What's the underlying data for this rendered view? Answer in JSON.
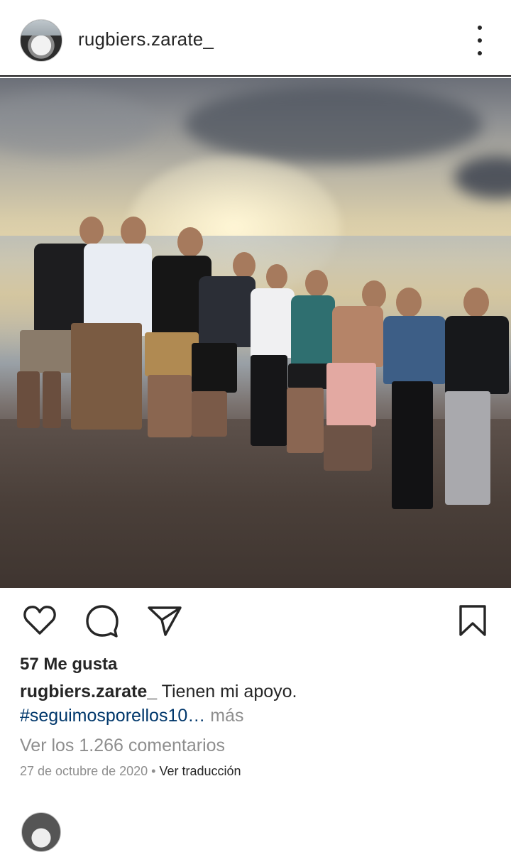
{
  "post": {
    "username": "rugbiers.zarate_",
    "likes": "57 Me gusta",
    "caption_user": "rugbiers.zarate_",
    "caption_text": "Tienen mi apoyo.",
    "hashtag": "#seguimosporellos10…",
    "more_label": "más",
    "comments_link": "Ver los 1.266 comentarios",
    "date": "27 de octubre de 2020",
    "separator": "•",
    "translate_label": "Ver traducción"
  },
  "icons": {
    "more": "more-vertical-icon",
    "like": "heart-icon",
    "comment": "comment-bubble-icon",
    "share": "paper-plane-icon",
    "save": "bookmark-icon"
  },
  "colors": {
    "text": "#262626",
    "secondary": "#8e8e8e",
    "link": "#00376b"
  }
}
